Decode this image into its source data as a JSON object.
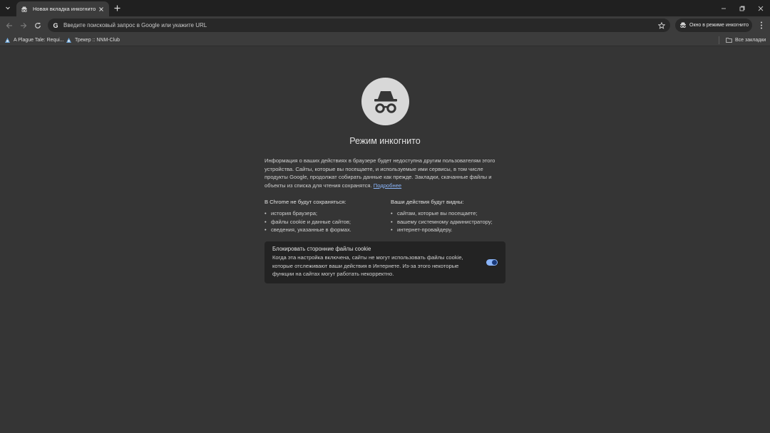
{
  "tab": {
    "title": "Новая вкладка инкогнито"
  },
  "omnibox": {
    "placeholder": "Введите поисковый запрос в Google или укажите URL"
  },
  "incognito_chip": {
    "label": "Окно в режиме инкогнито"
  },
  "bookmarks": {
    "items": [
      {
        "label": "A Plague Tale: Requi..."
      },
      {
        "label": "Трекер :: NNM-Club"
      }
    ],
    "all_bookmarks": "Все закладки"
  },
  "page": {
    "title": "Режим инкогнито",
    "description": "Информация о ваших действиях в браузере будет недоступна другим пользователям этого устройства. Сайты, которые вы посещаете, и используемые ими сервисы, в том числе продукты Google, продолжат собирать данные как прежде. Закладки, скачанные файлы и объекты из списка для чтения сохранятся.",
    "learn_more": "Подробнее",
    "not_saved": {
      "heading": "В Chrome не будут сохраняться:",
      "items": [
        "история браузера;",
        "файлы cookie и данные сайтов;",
        "сведения, указанные в формах."
      ]
    },
    "visible_to": {
      "heading": "Ваши действия будут видны:",
      "items": [
        "сайтам, которые вы посещаете;",
        "вашему системному администратору;",
        "интернет-провайдеру."
      ]
    },
    "cookie_card": {
      "title": "Блокировать сторонние файлы cookie",
      "text": "Когда эта настройка включена, сайты не могут использовать файлы cookie, которые отслеживают ваши действия в Интернете. Из-за этого некоторые функции на сайтах могут работать некорректно.",
      "toggle_on": true
    }
  },
  "colors": {
    "page_bg": "#353535",
    "toolbar_bg": "#3c3c3c",
    "titlebar_bg": "#202020",
    "link": "#8ab4f8",
    "toggle": "#8ab4f8"
  }
}
